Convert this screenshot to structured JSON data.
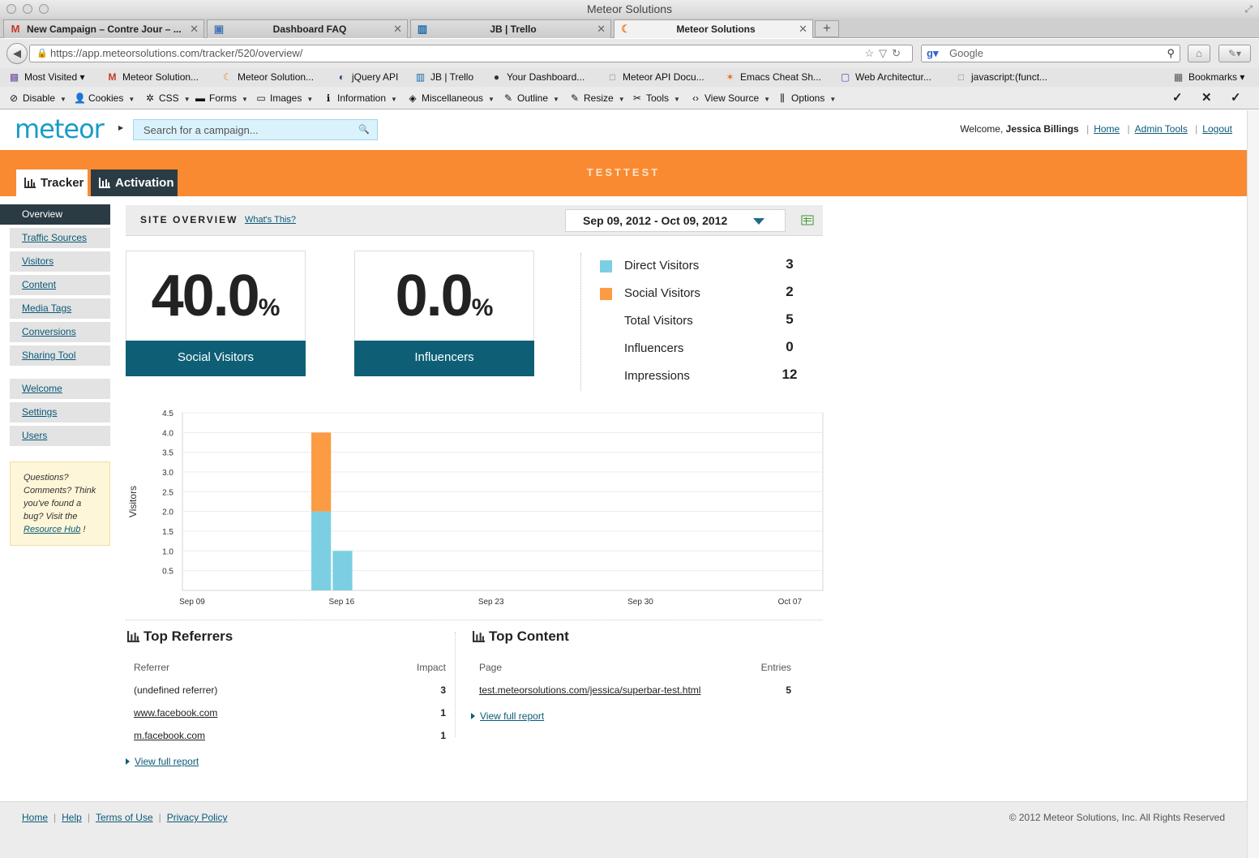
{
  "window": {
    "title": "Meteor Solutions"
  },
  "tabs": [
    {
      "label": "New Campaign – Contre Jour – ...",
      "icon": "gmail-icon",
      "active": false
    },
    {
      "label": "Dashboard FAQ",
      "icon": "page-icon",
      "active": false
    },
    {
      "label": "JB | Trello",
      "icon": "trello-icon",
      "active": false
    },
    {
      "label": "Meteor Solutions",
      "icon": "meteor-icon",
      "active": true
    }
  ],
  "address": {
    "url": "https://app.meteorsolutions.com/tracker/520/overview/",
    "search_placeholder": "Google"
  },
  "bookmarks": [
    "Most Visited",
    "Meteor Solution...",
    "Meteor Solution...",
    "jQuery API",
    "JB | Trello",
    "Your Dashboard...",
    "Meteor API Docu...",
    "Emacs Cheat Sh...",
    "Web Architectur...",
    "javascript:(funct...",
    "Bookmarks"
  ],
  "devtools": [
    "Disable",
    "Cookies",
    "CSS",
    "Forms",
    "Images",
    "Information",
    "Miscellaneous",
    "Outline",
    "Resize",
    "Tools",
    "View Source",
    "Options"
  ],
  "app": {
    "logo": "meteor",
    "search_placeholder": "Search for a campaign...",
    "welcome_prefix": "Welcome,",
    "user_name": "Jessica Billings",
    "links": {
      "home": "Home",
      "admin": "Admin Tools",
      "logout": "Logout"
    },
    "campaign_title": "TESTTEST",
    "main_tabs": {
      "tracker": "Tracker",
      "activation": "Activation"
    }
  },
  "sidebar": {
    "items": [
      "Overview",
      "Traffic Sources",
      "Visitors",
      "Content",
      "Media Tags",
      "Conversions",
      "Sharing Tool"
    ],
    "items2": [
      "Welcome",
      "Settings",
      "Users"
    ],
    "help": {
      "pre": "Questions? Comments? Think you've found a bug? Visit the ",
      "link": "Resource Hub",
      "post": " !"
    }
  },
  "overview": {
    "title": "SITE OVERVIEW",
    "whats_this": "What's This?",
    "date_range": "Sep 09, 2012 - Oct 09, 2012"
  },
  "metrics": [
    {
      "value": "40.0",
      "unit": "%",
      "label": "Social Visitors"
    },
    {
      "value": "0.0",
      "unit": "%",
      "label": "Influencers"
    }
  ],
  "stats": [
    {
      "label": "Direct Visitors",
      "value": "3",
      "color": "#7ccfe2"
    },
    {
      "label": "Social Visitors",
      "value": "2",
      "color": "#fb9b43"
    },
    {
      "label": "Total Visitors",
      "value": "5",
      "color": ""
    },
    {
      "label": "Influencers",
      "value": "0",
      "color": ""
    },
    {
      "label": "Impressions",
      "value": "12",
      "color": ""
    }
  ],
  "chart_data": {
    "type": "bar",
    "stacked": true,
    "ylabel": "Visitors",
    "xlabel": "",
    "ylim": [
      0,
      4.5
    ],
    "yticks": [
      "0.5",
      "1.0",
      "1.5",
      "2.0",
      "2.5",
      "3.0",
      "3.5",
      "4.0",
      "4.5"
    ],
    "xlim": [
      "2012-09-09",
      "2012-10-09"
    ],
    "xticks": [
      {
        "label": "Sep 09",
        "date": "2012-09-09"
      },
      {
        "label": "Sep 16",
        "date": "2012-09-16"
      },
      {
        "label": "Sep 23",
        "date": "2012-09-23"
      },
      {
        "label": "Sep 30",
        "date": "2012-09-30"
      },
      {
        "label": "Oct 07",
        "date": "2012-10-07"
      }
    ],
    "grid": true,
    "dates": [
      "2012-09-15",
      "2012-09-16"
    ],
    "series": [
      {
        "name": "Direct Visitors",
        "color": "#7ccfe2",
        "values": [
          2,
          1
        ]
      },
      {
        "name": "Social Visitors",
        "color": "#fb9b43",
        "values": [
          2,
          0
        ]
      }
    ]
  },
  "referrers": {
    "title": "Top Referrers",
    "col_referrer": "Referrer",
    "col_impact": "Impact",
    "rows": [
      {
        "name": "(undefined referrer)",
        "impact": "3",
        "link": false
      },
      {
        "name": "www.facebook.com",
        "impact": "1",
        "link": true
      },
      {
        "name": "m.facebook.com",
        "impact": "1",
        "link": true
      }
    ],
    "full_report": "View full report"
  },
  "content": {
    "title": "Top Content",
    "col_page": "Page",
    "col_entries": "Entries",
    "rows": [
      {
        "page": "test.meteorsolutions.com/jessica/superbar-test.html",
        "entries": "5"
      }
    ],
    "full_report": "View full report"
  },
  "footer": {
    "links": [
      "Home",
      "Help",
      "Terms of Use",
      "Privacy Policy"
    ],
    "copyright": "© 2012 Meteor Solutions, Inc. All Rights Reserved"
  }
}
